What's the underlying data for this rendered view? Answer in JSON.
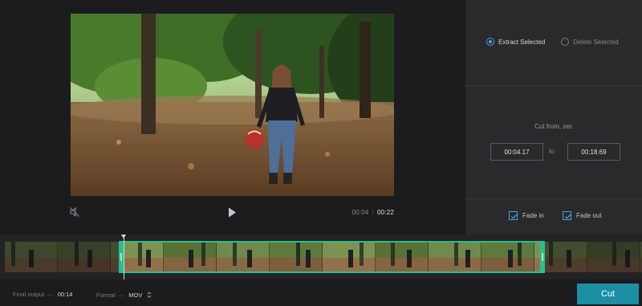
{
  "icons": {
    "back": "chevron-left-icon",
    "mute": "speaker-muted-icon",
    "play": "play-icon",
    "format_dropdown": "chevron-updown-icon",
    "checkbox": "checkmark-icon"
  },
  "player": {
    "current_time": "00:04",
    "separator": "/",
    "duration": "00:22"
  },
  "mode": {
    "extract_label": "Extract Selected",
    "delete_label": "Delete Selected",
    "selected": "extract"
  },
  "cut": {
    "title": "Cut from, sec",
    "from_value": "00:04.17",
    "to_label": "to",
    "to_value": "00:18.69"
  },
  "effects": {
    "fade_in_label": "Fade in",
    "fade_in_checked": true,
    "fade_out_label": "Fade out",
    "fade_out_checked": true
  },
  "footer": {
    "final_output_label": "Final output",
    "dash": "—",
    "final_output_value": "00:14",
    "format_label": "Format",
    "format_value": "MOV",
    "cut_button_label": "Cut"
  },
  "colors": {
    "accent_blue": "#3da7e0",
    "selection_green": "#27c08e",
    "cut_button": "#1c8fa4",
    "panel_bg": "#2a2a2c",
    "app_bg": "#1c1c1e"
  }
}
